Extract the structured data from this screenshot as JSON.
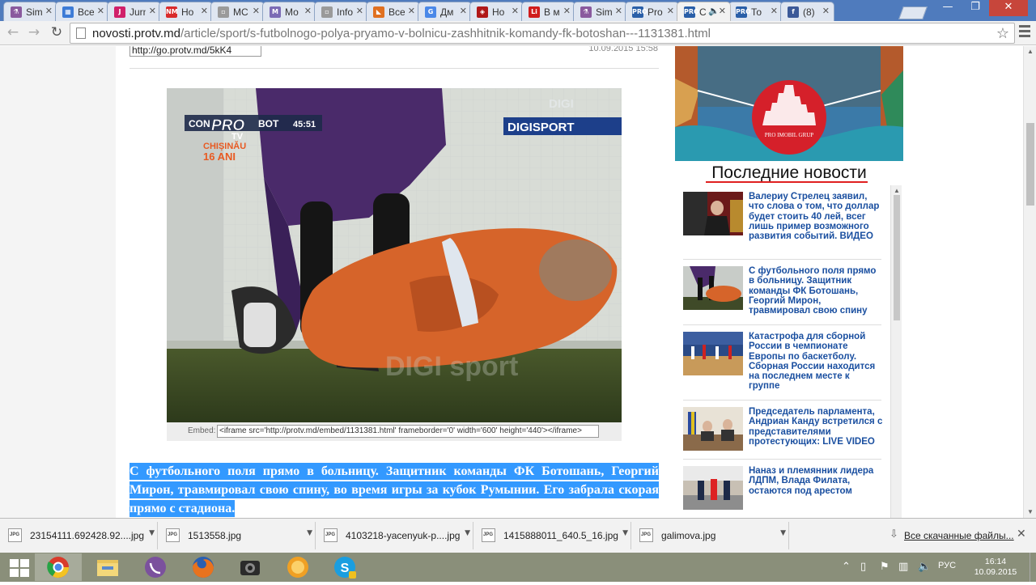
{
  "tabs": [
    {
      "title": "Sim",
      "color": "#8a5a9e",
      "glyph": "⚗"
    },
    {
      "title": "Все",
      "color": "#3d7bd6",
      "glyph": "▦"
    },
    {
      "title": "Jurn",
      "color": "#d0206a",
      "glyph": "J"
    },
    {
      "title": "Ho",
      "color": "#d92b2b",
      "glyph": "NM"
    },
    {
      "title": "МС",
      "color": "#9a9a9a",
      "glyph": "▫"
    },
    {
      "title": "Мо",
      "color": "#7b6bb5",
      "glyph": "M"
    },
    {
      "title": "Info",
      "color": "#9a9a9a",
      "glyph": "▫"
    },
    {
      "title": "Все",
      "color": "#e07020",
      "glyph": "◣"
    },
    {
      "title": "Дм",
      "color": "#4a88e8",
      "glyph": "G"
    },
    {
      "title": "Ho",
      "color": "#b01818",
      "glyph": "◈"
    },
    {
      "title": "В м",
      "color": "#d01c1c",
      "glyph": "Li"
    },
    {
      "title": "Sim",
      "color": "#8a5a9e",
      "glyph": "⚗"
    },
    {
      "title": "Pro",
      "color": "#2a5fa8",
      "glyph": "PRO"
    },
    {
      "title": "С",
      "color": "#2a5fa8",
      "glyph": "PRO",
      "active": true,
      "audio": "🔈"
    },
    {
      "title": "То",
      "color": "#2a5fa8",
      "glyph": "PRO"
    },
    {
      "title": "(8)",
      "color": "#3b5998",
      "glyph": "f"
    }
  ],
  "window": {
    "minimize": "—",
    "restore": "❐",
    "close": "✕"
  },
  "toolbar": {
    "back": "←",
    "forward": "→",
    "reload": "↻",
    "url_host": "novosti.protv.md",
    "url_path": "/article/sport/s-futbolnogo-polya-pryamo-v-bolnicu-zashhitnik-komandy-fk-botoshan---1131381.html",
    "star": "☆"
  },
  "article": {
    "short_link": "http://go.protv.md/5kK4",
    "date": "10.09.2015 15:58",
    "video": {
      "score_left": "CON",
      "score_right": "BOT",
      "time": "45:51",
      "channel_logo": "PRO",
      "channel_sub": "TV",
      "city": "CHIȘINĂU",
      "years": "16 ANI",
      "broadcaster": "DIGISPORT",
      "watermark_top": "DIGI",
      "watermark_bottom": "DIGI sport"
    },
    "embed_label": "Embed:",
    "embed_code": "<iframe src='http://protv.md/embed/1131381.html' frameborder='0' width='600' height='440'></iframe>",
    "lead": "С футбольного поля прямо в больницу. Защитник команды ФК Ботошань, Георгий Мирон, травмировал свою спину, во время игры за кубок Румынии. Его забрала скорая прямо с стадиона."
  },
  "sidebar": {
    "banner_text": "PRO IMOBIL GRUP",
    "news_title": "Последние новости",
    "news": [
      {
        "title": "Валериу Стрелец заявил, что слова о том, что доллар будет стоить 40 лей, всег лишь пример возможного развития событий. ВИДЕО"
      },
      {
        "title": "С футбольного поля прямо в больницу. Защитник команды ФК Ботошань, Георгий Мирон, травмировал свою спину"
      },
      {
        "title": "Катастрофа для сборной России в чемпионате Европы по баскетболу. Сборная России находится на последнем месте к группе"
      },
      {
        "title": "Председатель парламента, Андриан Канду встретился с представителями протестующих: LIVE VIDEO"
      },
      {
        "title": "Наназ и племянник лидера ЛДПМ, Влада Филата, остаются под арестом"
      }
    ]
  },
  "downloads": {
    "items": [
      {
        "name": "23154111.692428.92....jpg"
      },
      {
        "name": "1513558.jpg"
      },
      {
        "name": "4103218-yacenyuk-p....jpg"
      },
      {
        "name": "1415888011_640.5_16.jpg"
      },
      {
        "name": "galimova.jpg"
      }
    ],
    "all_label": "Все скачанные файлы...",
    "close": "✕"
  },
  "taskbar": {
    "apps": [
      "chrome",
      "explorer",
      "viber",
      "firefox",
      "camera",
      "torrent",
      "skype"
    ],
    "lang": "РУС",
    "time": "16:14",
    "date": "10.09.2015"
  }
}
